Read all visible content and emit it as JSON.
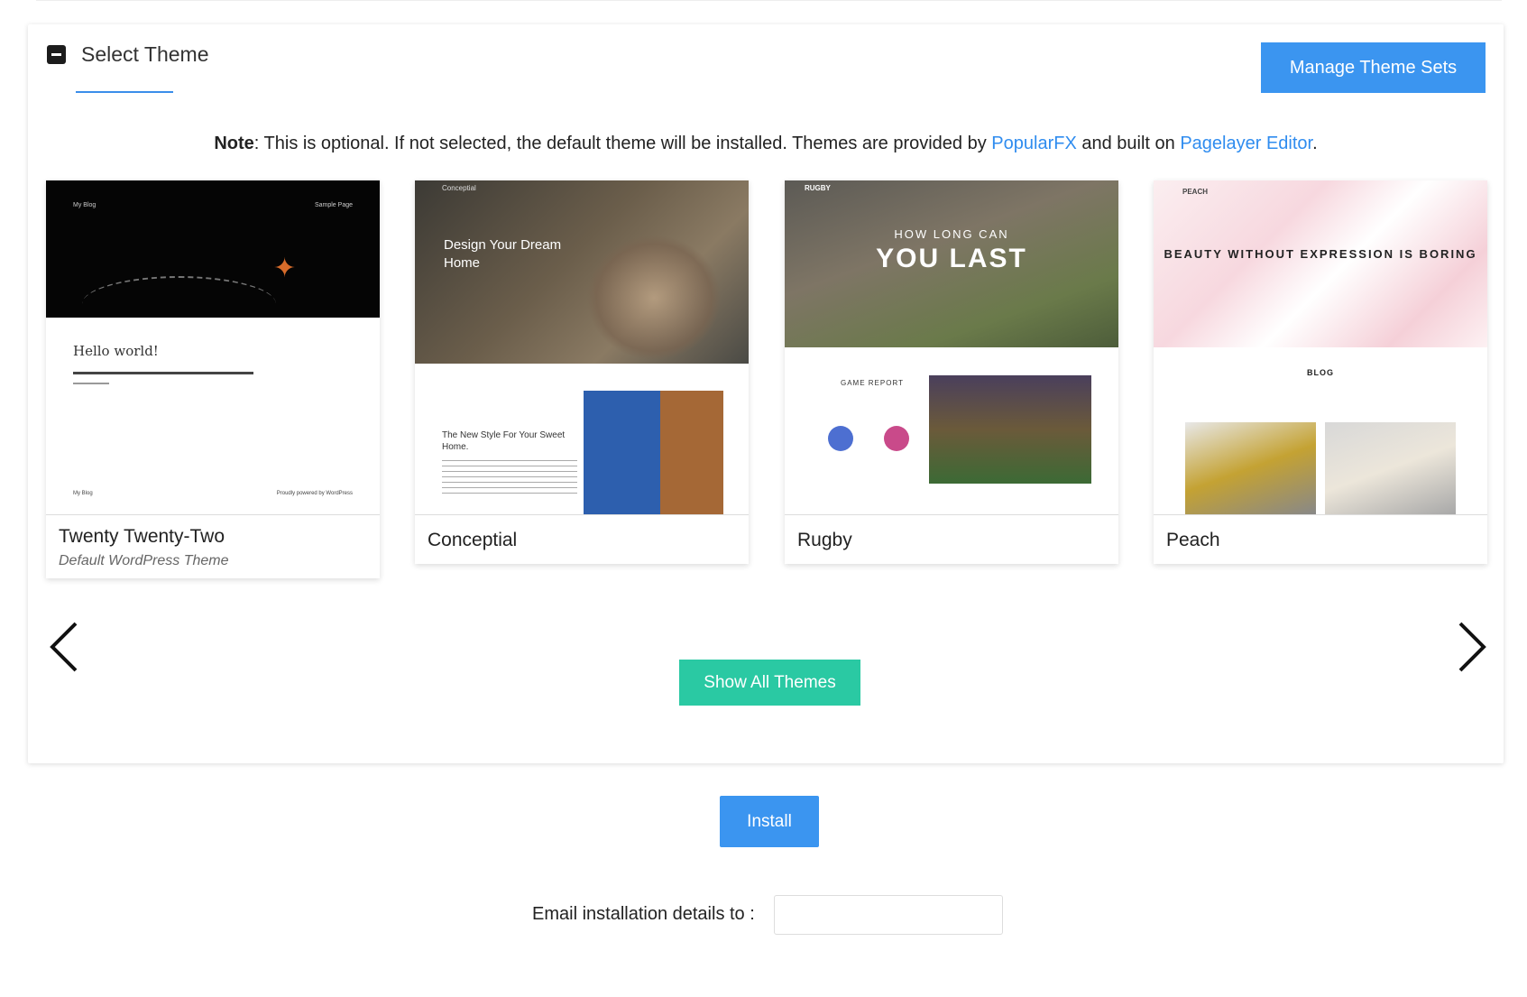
{
  "panel": {
    "title": "Select Theme",
    "manage_button": "Manage Theme Sets",
    "note": {
      "bold": "Note",
      "text1": ": This is optional. If not selected, the default theme will be installed. Themes are provided by ",
      "link1": "PopularFX",
      "text2": " and built on ",
      "link2": "Pagelayer Editor",
      "text3": "."
    },
    "themes": [
      {
        "name": "Twenty Twenty-Two",
        "subtitle": "Default WordPress Theme",
        "preview": {
          "blog": "My Blog",
          "sample": "Sample Page",
          "heading": "Hello world!",
          "footer_left": "My Blog",
          "footer_right": "Proudly powered by WordPress"
        }
      },
      {
        "name": "Conceptial",
        "preview": {
          "brand": "Conceptial",
          "heading": "Design Your Dream Home",
          "heading2": "The New Style For Your Sweet Home."
        }
      },
      {
        "name": "Rugby",
        "preview": {
          "brand": "RUGBY",
          "line1": "HOW LONG CAN",
          "line2": "YOU LAST",
          "section": "GAME REPORT"
        }
      },
      {
        "name": "Peach",
        "preview": {
          "brand": "PEACH",
          "heading": "BEAUTY WITHOUT EXPRESSION IS BORING",
          "section": "BLOG"
        }
      }
    ],
    "show_all_button": "Show All Themes"
  },
  "install_button": "Install",
  "email": {
    "label": "Email installation details to :",
    "value": ""
  },
  "colors": {
    "accent_blue": "#3b95f0",
    "accent_green": "#2ac9a3",
    "link": "#2f8cef"
  },
  "icons": [
    "collapse-icon",
    "chevron-left-icon",
    "chevron-right-icon"
  ]
}
